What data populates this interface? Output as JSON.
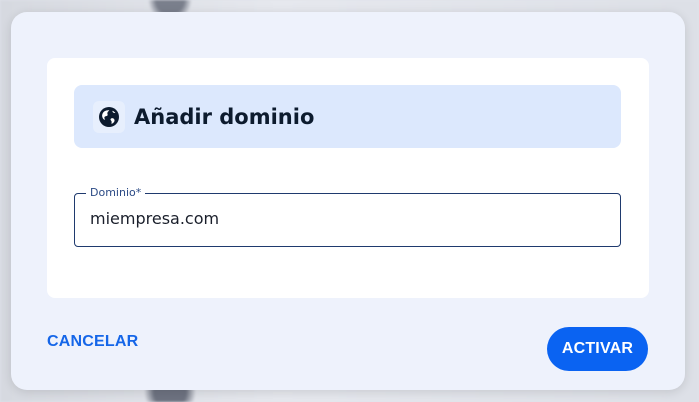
{
  "dialog": {
    "title": "Añadir dominio",
    "title_icon": "globe-icon",
    "field": {
      "label": "Dominio*",
      "value": "miempresa.com"
    },
    "actions": {
      "cancel_label": "CANCELAR",
      "activate_label": "ACTIVAR"
    }
  },
  "colors": {
    "accent": "#0a63f2",
    "header_bg": "#dce8fd",
    "dialog_bg": "#eef2fc"
  }
}
